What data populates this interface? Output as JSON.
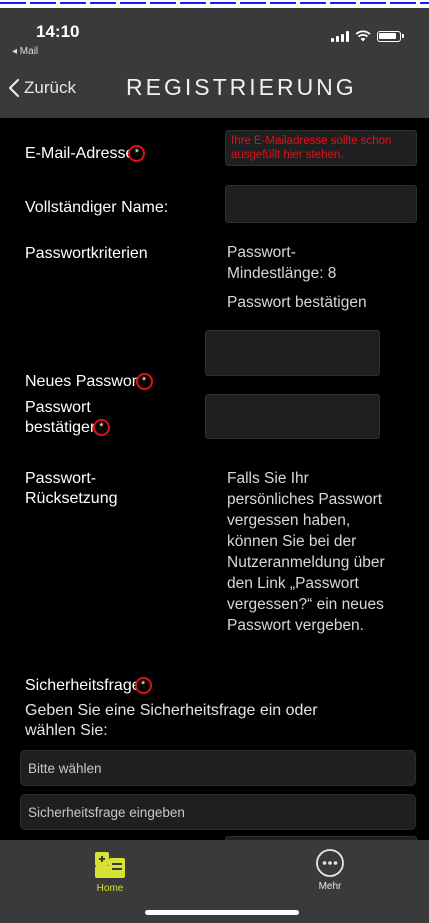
{
  "status": {
    "time": "14:10",
    "back_app": "◂ Mail"
  },
  "nav": {
    "back_label": "Zurück",
    "title": "REGISTRIERUNG"
  },
  "form": {
    "email_label": "E-Mail-Adresse",
    "email_hint": "Ihre E-Mailadresse sollte schon ausgefüllt hier stehen.",
    "fullname_label": "Vollständiger Name:",
    "criteria_label": "Passwortkriterien",
    "criteria_line1": "Passwort-",
    "criteria_line2": "Mindestlänge: 8",
    "criteria_line3": "Passwort bestätigen",
    "newpw_label": "Neues Passwort",
    "confirm_label_1": "Passwort",
    "confirm_label_2": "bestätigen",
    "reset_label_1": "Passwort-",
    "reset_label_2": "Rücksetzung",
    "reset_text": [
      "Falls Sie Ihr",
      "persönliches Passwort",
      "vergessen haben,",
      "können Sie bei der",
      "Nutzeranmeldung über",
      "den Link „Passwort",
      "vergessen?“ ein neues",
      "Passwort vergeben."
    ],
    "security_label": "Sicherheitsfrage",
    "security_desc_1": "Geben Sie eine Sicherheitsfrage ein oder",
    "security_desc_2": "wählen Sie:",
    "select_value": "Bitte wählen",
    "question_placeholder": "Sicherheitsfrage eingeben",
    "required_marker": "*"
  },
  "tabs": {
    "home": "Home",
    "more": "Mehr"
  },
  "colors": {
    "accent": "#d6e234",
    "required": "#e3101b",
    "bar": "#3a3a3a"
  }
}
